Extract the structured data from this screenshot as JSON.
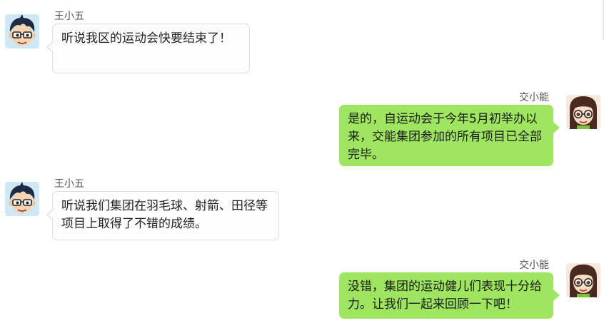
{
  "colors": {
    "left_bubble_bg": "#fdfdfd",
    "left_bubble_border": "#dddddd",
    "right_bubble_bg": "#9ee65f",
    "name_text": "#555555"
  },
  "messages": [
    {
      "side": "left",
      "sender": "王小五",
      "avatar": "boy-avatar",
      "text": "听说我区的运动会快要结束了！"
    },
    {
      "side": "right",
      "sender": "交小能",
      "avatar": "girl-avatar",
      "text": "是的，自运动会于今年5月初举办以来，交能集团参加的所有项目已全部完毕。"
    },
    {
      "side": "left",
      "sender": "王小五",
      "avatar": "boy-avatar",
      "text": "听说我们集团在羽毛球、射箭、田径等项目上取得了不错的成绩。"
    },
    {
      "side": "right",
      "sender": "交小能",
      "avatar": "girl-avatar",
      "text": "没错，集团的运动健儿们表现十分给力。让我们一起来回顾一下吧！"
    }
  ]
}
